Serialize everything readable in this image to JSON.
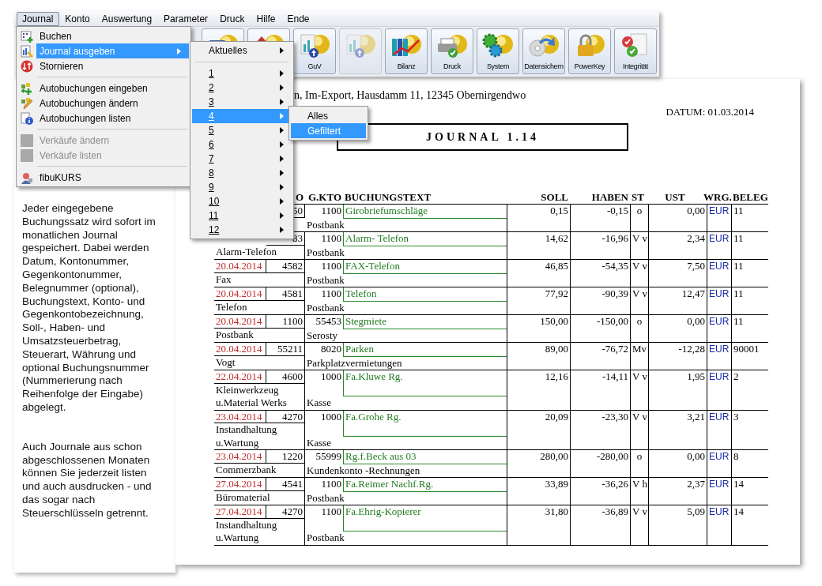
{
  "menubar": [
    {
      "label": "Journal",
      "selected": true
    },
    {
      "label": "Konto",
      "selected": false
    },
    {
      "label": "Auswertung",
      "selected": false
    },
    {
      "label": "Parameter",
      "selected": false
    },
    {
      "label": "Druck",
      "selected": false
    },
    {
      "label": "Hilfe",
      "selected": false
    },
    {
      "label": "Ende",
      "selected": false
    }
  ],
  "toolbar": [
    {
      "kind": "card",
      "disabled": false
    },
    {
      "kind": "house",
      "disabled": false
    },
    {
      "kind": "chart",
      "label": "GuV",
      "disabled": false
    },
    {
      "kind": "chart",
      "disabled": true
    },
    {
      "kind": "binders",
      "label": "Bilanz",
      "disabled": false
    },
    {
      "kind": "printer",
      "label": "Druck",
      "disabled": false
    },
    {
      "kind": "gears",
      "label": "System",
      "disabled": false
    },
    {
      "kind": "disc",
      "label": "Datensichern",
      "disabled": false
    },
    {
      "kind": "lock",
      "label": "PowerKey",
      "disabled": false
    },
    {
      "kind": "checks",
      "label": "Integrität",
      "disabled": false
    }
  ],
  "journal_menu": [
    {
      "kind": "grid",
      "label": "Buchen",
      "selected": false,
      "disabled": false,
      "submenu": false
    },
    {
      "kind": "journal",
      "label": "Journal ausgeben",
      "selected": true,
      "disabled": false,
      "submenu": true
    },
    {
      "kind": "cancel",
      "label": "Stornieren",
      "selected": false,
      "disabled": false,
      "submenu": false
    },
    {
      "kind": "separator"
    },
    {
      "kind": "add",
      "label": "Autobuchungen eingeben",
      "selected": false,
      "disabled": false,
      "submenu": false
    },
    {
      "kind": "edit",
      "label": "Autobuchungen ändern",
      "selected": false,
      "disabled": false,
      "submenu": false
    },
    {
      "kind": "info",
      "label": "Autobuchungen listen",
      "selected": false,
      "disabled": false,
      "submenu": false
    },
    {
      "kind": "separator"
    },
    {
      "kind": "blank",
      "label": "Verkäufe ändern",
      "selected": false,
      "disabled": true,
      "submenu": false
    },
    {
      "kind": "blank",
      "label": "Verkäufe listen",
      "selected": false,
      "disabled": true,
      "submenu": false
    },
    {
      "kind": "separator"
    },
    {
      "kind": "person",
      "label": "fibuKURS",
      "selected": false,
      "disabled": false,
      "submenu": false
    }
  ],
  "journal_submenu": [
    {
      "kind": "item",
      "label": "Aktuelles",
      "selected": false
    },
    {
      "kind": "separator"
    },
    {
      "kind": "month",
      "label": "1",
      "selected": false
    },
    {
      "kind": "month",
      "label": "2",
      "selected": false
    },
    {
      "kind": "month",
      "label": "3",
      "selected": false
    },
    {
      "kind": "month",
      "label": "4",
      "selected": true
    },
    {
      "kind": "month",
      "label": "5",
      "selected": false
    },
    {
      "kind": "month",
      "label": "6",
      "selected": false
    },
    {
      "kind": "month",
      "label": "7",
      "selected": false
    },
    {
      "kind": "month",
      "label": "8",
      "selected": false
    },
    {
      "kind": "month",
      "label": "9",
      "selected": false
    },
    {
      "kind": "month",
      "label": "10",
      "selected": false
    },
    {
      "kind": "month",
      "label": "11",
      "selected": false
    },
    {
      "kind": "month",
      "label": "12",
      "selected": false
    }
  ],
  "month_submenu": [
    {
      "label": "Alles",
      "selected": false
    },
    {
      "label": "Gefiltert",
      "selected": true
    }
  ],
  "info_text": [
    "Jeder eingegebene Buchungssatz wird sofort im monatlichen Journal gespeichert. Dabei werden Datum, Kontonummer, Gegenkontonummer, Belegnummer (optional), Buchungstext, Konto- und Gegenkontobezeichnung, Soll-, Haben- und Umsatzsteuerbetrag, Steuerart, Währung und optional Buchungsnummer (Nummerierung nach Reihenfolge der Eingabe) abgelegt.",
    "Auch Journale aus schon abgeschlossenen Monaten können Sie jederzeit listen und auch ausdrucken - und das sogar nach Steuerschlüsseln getrennt."
  ],
  "report": {
    "address": "n, Im-Export, Hausdamm 11, 12345 Obernirgendwo",
    "date": "DATUM: 01.03.2014",
    "title": "JOURNAL 1.14",
    "columns": [
      "O",
      "G.KTO",
      "BUCHUNGSTEXT",
      "SOLL",
      "HABEN",
      "ST",
      "UST",
      "WRG.",
      "BELEG"
    ],
    "rows": [
      {
        "konto": "50",
        "gkto": "1100",
        "text": "Girobriefumschläge",
        "gkto_name": "Postbank",
        "soll": "0,15",
        "haben": "-0,15",
        "st": "o",
        "ust": "0,00",
        "wrg": "EUR",
        "beleg": "11"
      },
      {
        "konto": "83",
        "gkto": "1100",
        "text": "Alarm- Telefon",
        "konto_name": "Alarm-Telefon",
        "gkto_name": "Postbank",
        "soll": "14,62",
        "haben": "-16,96",
        "st": "V v",
        "ust": "2,34",
        "wrg": "EUR",
        "beleg": "11"
      },
      {
        "date": "20.04.2014",
        "konto": "4582",
        "gkto": "1100",
        "text": "FAX-Telefon",
        "konto_name": "Fax",
        "gkto_name": "Postbank",
        "soll": "46,85",
        "haben": "-54,35",
        "st": "V v",
        "ust": "7,50",
        "wrg": "EUR",
        "beleg": "11"
      },
      {
        "date": "20.04.2014",
        "konto": "4581",
        "gkto": "1100",
        "text": "Telefon",
        "konto_name": "Telefon",
        "gkto_name": "Postbank",
        "soll": "77,92",
        "haben": "-90,39",
        "st": "V v",
        "ust": "12,47",
        "wrg": "EUR",
        "beleg": "11"
      },
      {
        "date": "20.04.2014",
        "konto": "1100",
        "gkto": "55453",
        "text": "Stegmiete",
        "konto_name": "Postbank",
        "gkto_name": "Serosty",
        "soll": "150,00",
        "haben": "-150,00",
        "st": "o",
        "ust": "0,00",
        "wrg": "EUR",
        "beleg": "11"
      },
      {
        "date": "20.04.2014",
        "konto": "55211",
        "gkto": "8020",
        "text": "Parken",
        "konto_name": "Vogt",
        "gkto_name": "Parkplatzvermietungen",
        "soll": "89,00",
        "haben": "-76,72",
        "st": "Mv",
        "ust": "-12,28",
        "wrg": "EUR",
        "beleg": "90001"
      },
      {
        "date": "22.04.2014",
        "konto": "4600",
        "gkto": "1000",
        "text": "Fa.Kluwe Rg.",
        "konto_name": "Kleinwerkzeug u.Material Werks",
        "gkto_name": "Kasse",
        "soll": "12,16",
        "haben": "-14,11",
        "st": "V v",
        "ust": "1,95",
        "wrg": "EUR",
        "beleg": "2"
      },
      {
        "date": "23.04.2014",
        "konto": "4270",
        "gkto": "1000",
        "text": "Fa.Grohe Rg.",
        "konto_name": "Instandhaltung u.Wartung",
        "gkto_name": "Kasse",
        "soll": "20,09",
        "haben": "-23,30",
        "st": "V v",
        "ust": "3,21",
        "wrg": "EUR",
        "beleg": "3"
      },
      {
        "date": "23.04.2014",
        "konto": "1220",
        "gkto": "55999",
        "text": "Rg.f.Beck aus 03",
        "konto_name": "Commerzbank",
        "gkto_name": "Kundenkonto -Rechnungen",
        "soll": "280,00",
        "haben": "-280,00",
        "st": "o",
        "ust": "0,00",
        "wrg": "EUR",
        "beleg": "8"
      },
      {
        "date": "27.04.2014",
        "konto": "4541",
        "gkto": "1100",
        "text": "Fa.Reimer Nachf.Rg.",
        "konto_name": "Büromaterial",
        "gkto_name": "Postbank",
        "soll": "33,89",
        "haben": "-36,26",
        "st": "V h",
        "ust": "2,37",
        "wrg": "EUR",
        "beleg": "14"
      },
      {
        "date": "27.04.2014",
        "konto": "4270",
        "gkto": "1100",
        "text": "Fa.Ehrig-Kopierer",
        "konto_name": "Instandhaltung u.Wartung",
        "gkto_name": "Postbank",
        "soll": "31,80",
        "haben": "-36,89",
        "st": "V v",
        "ust": "5,09",
        "wrg": "EUR",
        "beleg": "14"
      }
    ]
  }
}
